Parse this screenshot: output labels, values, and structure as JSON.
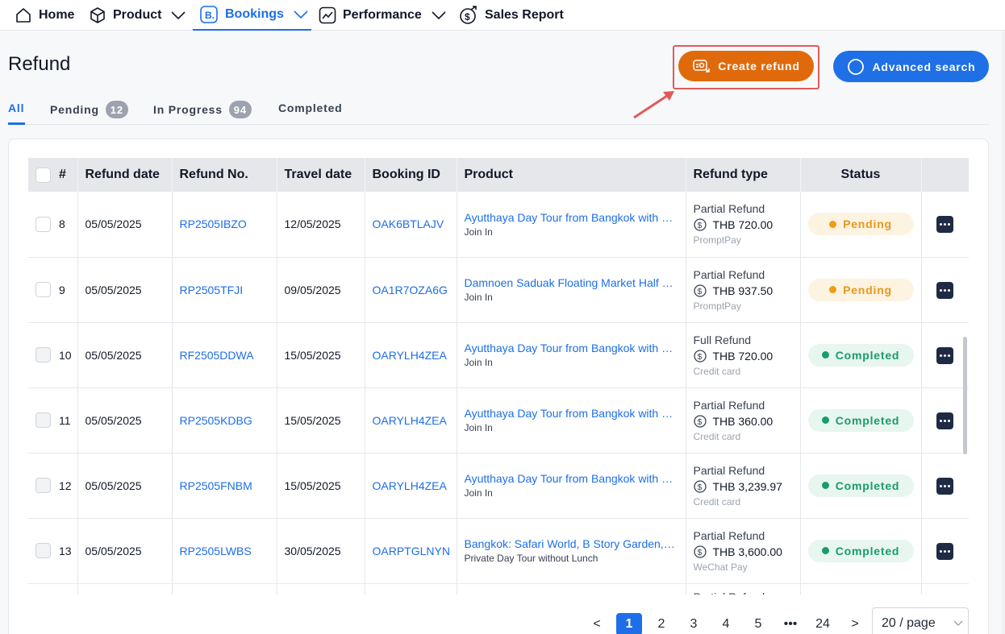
{
  "nav": {
    "home": "Home",
    "product": "Product",
    "bookings": "Bookings",
    "performance": "Performance",
    "sales_report": "Sales Report"
  },
  "header": {
    "title": "Refund",
    "create_refund": "Create refund",
    "advanced_search": "Advanced search"
  },
  "tabs": {
    "all": "All",
    "pending": "Pending",
    "pending_count": "12",
    "in_progress": "In Progress",
    "in_progress_count": "94",
    "completed": "Completed"
  },
  "table": {
    "columns": {
      "num": "#",
      "refund_date": "Refund date",
      "refund_no": "Refund No.",
      "travel_date": "Travel date",
      "booking_id": "Booking ID",
      "product": "Product",
      "refund_type": "Refund type",
      "status": "Status"
    },
    "rows": [
      {
        "num": "8",
        "refund_date": "05/05/2025",
        "refund_no": "RP2505IBZO",
        "travel_date": "12/05/2025",
        "booking_id": "OAK6BTLAJV",
        "product": "Ayutthaya Day Tour from Bangkok with Lunch",
        "product_sub": "Join In",
        "refund_type": "Partial Refund",
        "amount": "THB 720.00",
        "method": "PromptPay",
        "status": "Pending"
      },
      {
        "num": "9",
        "refund_date": "05/05/2025",
        "refund_no": "RP2505TFJI",
        "travel_date": "09/05/2025",
        "booking_id": "OA1R7OZA6G",
        "product": "Damnoen Saduak Floating Market Half Day Tour",
        "product_sub": "Join In",
        "refund_type": "Partial Refund",
        "amount": "THB 937.50",
        "method": "PromptPay",
        "status": "Pending"
      },
      {
        "num": "10",
        "refund_date": "05/05/2025",
        "refund_no": "RF2505DDWA",
        "travel_date": "15/05/2025",
        "booking_id": "OARYLH4ZEA",
        "product": "Ayutthaya Day Tour from Bangkok with Lunch",
        "product_sub": "Join In",
        "refund_type": "Full Refund",
        "amount": "THB 720.00",
        "method": "Credit card",
        "status": "Completed"
      },
      {
        "num": "11",
        "refund_date": "05/05/2025",
        "refund_no": "RP2505KDBG",
        "travel_date": "15/05/2025",
        "booking_id": "OARYLH4ZEA",
        "product": "Ayutthaya Day Tour from Bangkok with Lunch",
        "product_sub": "Join In",
        "refund_type": "Partial Refund",
        "amount": "THB 360.00",
        "method": "Credit card",
        "status": "Completed"
      },
      {
        "num": "12",
        "refund_date": "05/05/2025",
        "refund_no": "RP2505FNBM",
        "travel_date": "15/05/2025",
        "booking_id": "OARYLH4ZEA",
        "product": "Ayutthaya Day Tour from Bangkok with Lunch",
        "product_sub": "Join In",
        "refund_type": "Partial Refund",
        "amount": "THB 3,239.97",
        "method": "Credit card",
        "status": "Completed"
      },
      {
        "num": "13",
        "refund_date": "05/05/2025",
        "refund_no": "RP2505LWBS",
        "travel_date": "30/05/2025",
        "booking_id": "OARPTGLNYN",
        "product": "Bangkok: Safari World, B Story Garden, and more",
        "product_sub": "Private Day Tour without Lunch",
        "refund_type": "Partial Refund",
        "amount": "THB 3,600.00",
        "method": "WeChat Pay",
        "status": "Completed"
      },
      {
        "num": "",
        "refund_date": "",
        "refund_no": "",
        "travel_date": "",
        "booking_id": "",
        "product": "",
        "product_sub": "",
        "refund_type": "Partial Refund",
        "amount": "",
        "method": "",
        "status": ""
      }
    ]
  },
  "pagination": {
    "prev": "<",
    "pages": [
      "1",
      "2",
      "3",
      "4",
      "5"
    ],
    "ellipsis": "•••",
    "last": "24",
    "next": ">",
    "page_size": "20 / page"
  }
}
